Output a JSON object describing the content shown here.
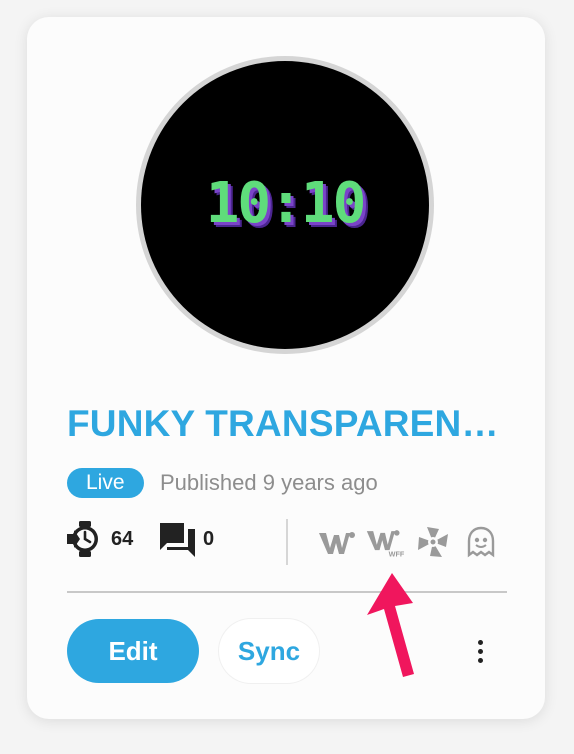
{
  "watchface": {
    "time": "10:10",
    "colors": {
      "digits": "#5fdc7b",
      "shadow": "#7a44c9",
      "face": "#000000",
      "bezel": "#d5d5d5"
    }
  },
  "title": "FUNKY TRANSPAREN…",
  "status_badge": "Live",
  "published": "Published 9 years ago",
  "stats": {
    "installs_icon": "watch-sync-icon",
    "installs": "64",
    "comments_icon": "comments-icon",
    "comments": "0"
  },
  "platforms": [
    "watchmaker-icon",
    "watch-face-format-icon",
    "tizen-icon",
    "ghost-icon"
  ],
  "actions": {
    "edit_label": "Edit",
    "sync_label": "Sync",
    "more_icon": "more-vertical-icon"
  },
  "annotation": {
    "arrow_color": "#f0165d"
  },
  "colors": {
    "accent": "#2ea7e0",
    "muted": "#8d8d8d"
  }
}
